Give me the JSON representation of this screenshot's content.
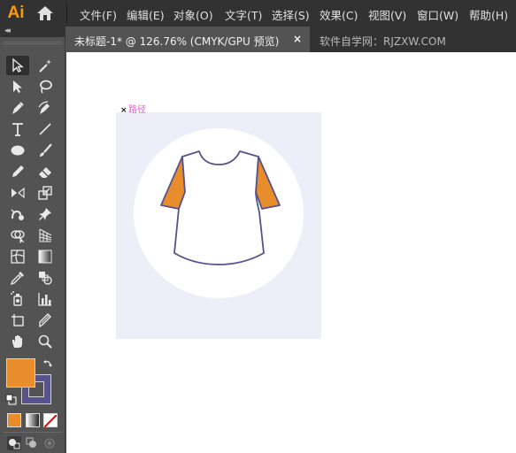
{
  "app": {
    "logo": "Ai"
  },
  "menu": [
    "文件(F)",
    "编辑(E)",
    "对象(O)",
    "文字(T)",
    "选择(S)",
    "效果(C)",
    "视图(V)",
    "窗口(W)",
    "帮助(H)"
  ],
  "tabs": {
    "active_title": "未标题-1* @ 126.76% (CMYK/GPU 预览)",
    "close_symbol": "×",
    "inactive_title": "软件自学网：RJZXW.COM"
  },
  "toolbar": {
    "collapse_symbol": "◂◂"
  },
  "canvas": {
    "path_label": "路径",
    "anchor_symbol": "×"
  },
  "colors": {
    "accent": "#ff9a00",
    "fill": "#e88d2b",
    "stroke": "#58538a",
    "sleeve": "#e88d2b",
    "shirt_body": "#ffffff",
    "outline": "#58538a",
    "artboard_bg": "#eeeef9",
    "path_label": "#e35bd6"
  },
  "icons": [
    "home-icon",
    "selection-tool-icon",
    "magic-wand-icon",
    "direct-selection-icon",
    "lasso-icon",
    "pen-icon",
    "curvature-icon",
    "type-icon",
    "line-icon",
    "ellipse-icon",
    "paintbrush-icon",
    "pencil-icon",
    "eraser-icon",
    "rotate-icon",
    "scale-icon",
    "warp-icon",
    "pin-icon",
    "shape-builder-icon",
    "perspective-grid-icon",
    "mesh-icon",
    "gradient-icon",
    "eyedropper-icon",
    "blend-icon",
    "symbol-sprayer-icon",
    "column-graph-icon",
    "artboard-icon",
    "slice-icon",
    "hand-icon",
    "zoom-icon"
  ]
}
